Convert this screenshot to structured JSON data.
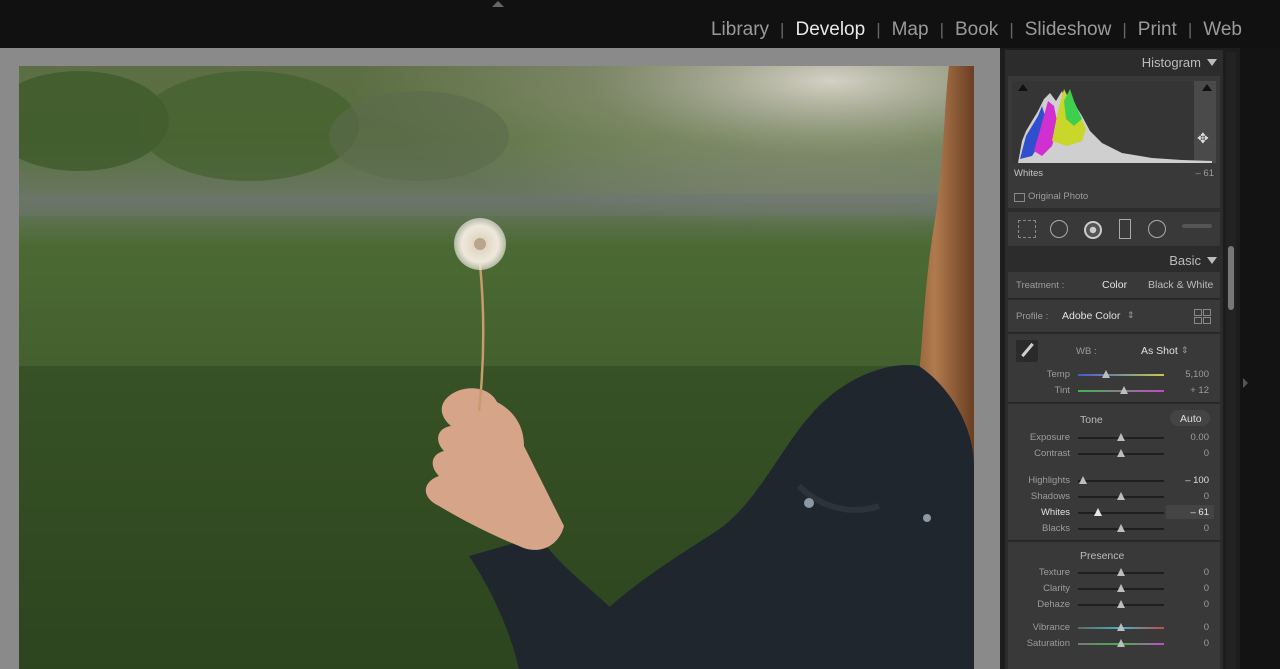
{
  "modules": [
    "Library",
    "Develop",
    "Map",
    "Book",
    "Slideshow",
    "Print",
    "Web"
  ],
  "active_module": "Develop",
  "histogram": {
    "title": "Histogram",
    "hover_label": "Whites",
    "hover_value": "– 61",
    "original_photo_label": "Original Photo"
  },
  "basic": {
    "title": "Basic",
    "treatment_label": "Treatment :",
    "treatment_color": "Color",
    "treatment_bw": "Black & White",
    "profile_label": "Profile :",
    "profile_value": "Adobe Color",
    "wb_label": "WB :",
    "wb_value": "As Shot",
    "tone_label": "Tone",
    "auto_label": "Auto",
    "presence_label": "Presence",
    "sliders": {
      "temp": {
        "label": "Temp",
        "value": "5,100"
      },
      "tint": {
        "label": "Tint",
        "value": "+ 12"
      },
      "exposure": {
        "label": "Exposure",
        "value": "0.00"
      },
      "contrast": {
        "label": "Contrast",
        "value": "0"
      },
      "highlights": {
        "label": "Highlights",
        "value": "– 100"
      },
      "shadows": {
        "label": "Shadows",
        "value": "0"
      },
      "whites": {
        "label": "Whites",
        "value": "– 61"
      },
      "blacks": {
        "label": "Blacks",
        "value": "0"
      },
      "texture": {
        "label": "Texture",
        "value": "0"
      },
      "clarity": {
        "label": "Clarity",
        "value": "0"
      },
      "dehaze": {
        "label": "Dehaze",
        "value": "0"
      },
      "vibrance": {
        "label": "Vibrance",
        "value": "0"
      },
      "saturation": {
        "label": "Saturation",
        "value": "0"
      }
    }
  }
}
